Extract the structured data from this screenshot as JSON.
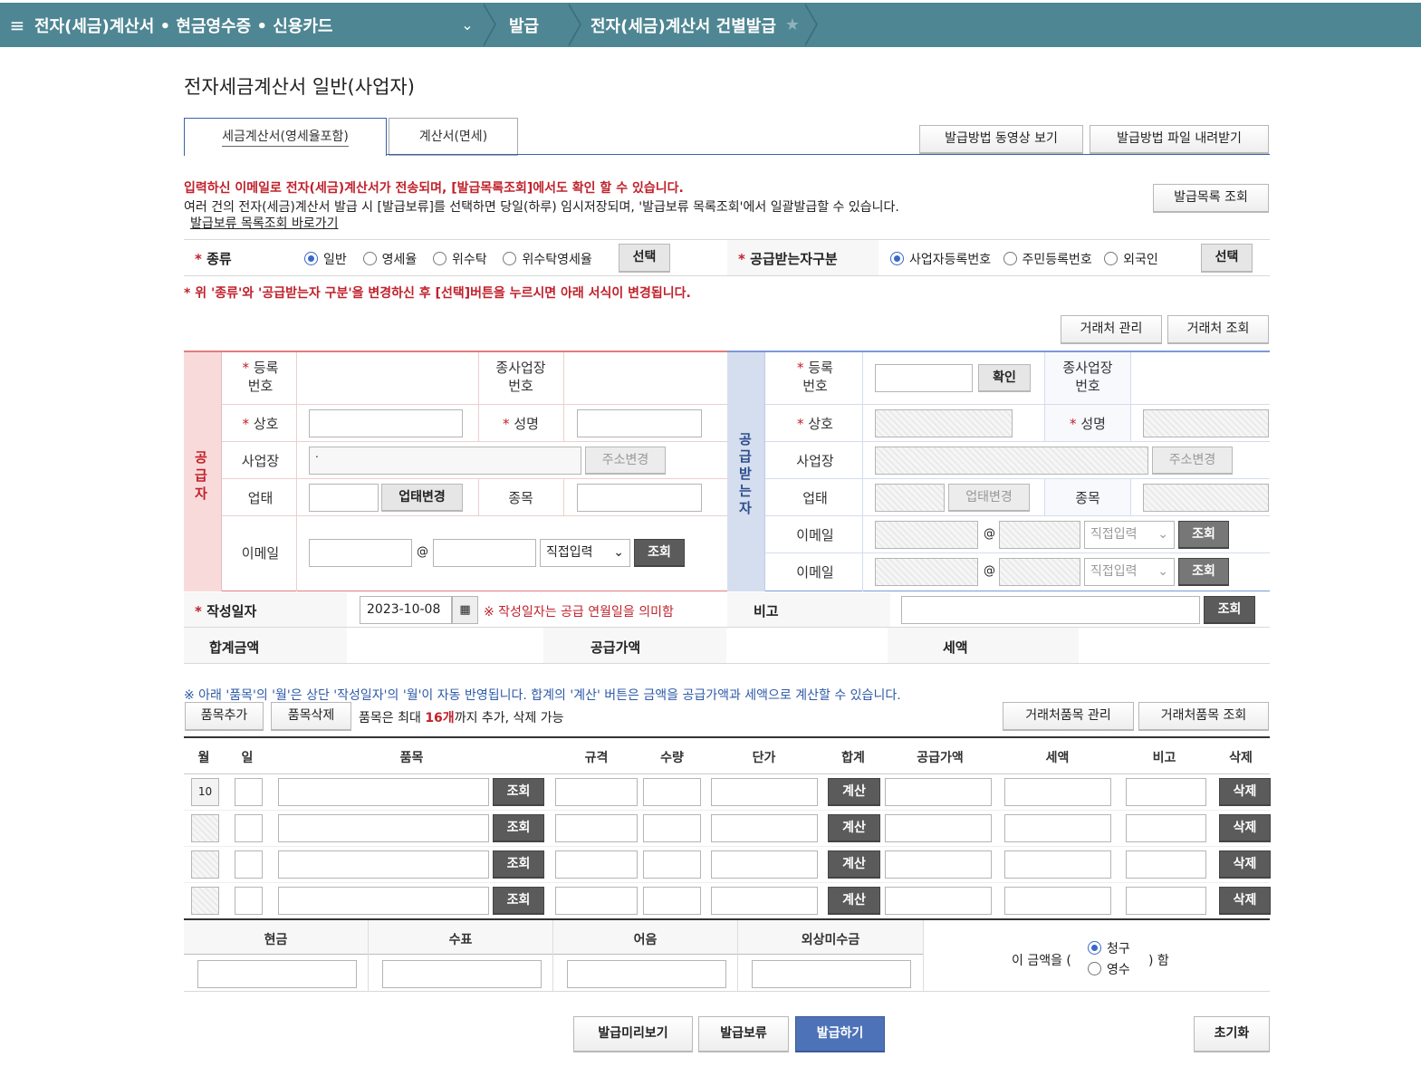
{
  "breadcrumb": {
    "menu": "≡",
    "section": "전자(세금)계산서 • 현금영수증 • 신용카드",
    "level2": "발급",
    "level3": "전자(세금)계산서 건별발급",
    "star": "★"
  },
  "page_title": "전자세금계산서 일반(사업자)",
  "tabs": [
    "세금계산서(영세율포함)",
    "계산서(면세)"
  ],
  "buttons": {
    "video": "발급방법 동영상 보기",
    "download": "발급방법 파일 내려받기",
    "issued_list": "발급목록 조회",
    "client_mgmt": "거래처 관리",
    "client_query": "거래처 조회",
    "item_mgmt": "거래처품목 관리",
    "item_query": "거래처품목 조회",
    "item_add": "품목추가",
    "item_del": "품목삭제",
    "preview": "발급미리보기",
    "hold": "발급보류",
    "issue": "발급하기",
    "reset": "초기화",
    "select": "선택",
    "confirm": "확인",
    "addr_change": "주소변경",
    "biz_change": "업태변경",
    "query": "조회",
    "calc": "계산",
    "delete": "삭제"
  },
  "notices": {
    "line1": "입력하신 이메일로 전자(세금)계산서가 전송되며, [발급목록조회]에서도 확인 할 수 있습니다.",
    "line2": "여러 건의 전자(세금)계산서 발급 시 [발급보류]를 선택하면 당일(하루) 임시저장되며, '발급보류 목록조회'에서 일괄발급할 수 있습니다.",
    "link": "발급보류 목록조회 바로가기",
    "form_change": "* 위 '종류'와 '공급받는자 구분'을 변경하신 후 [선택]버튼을 누르시면 아래 서식이 변경됩니다.",
    "item_note": "※ 아래 '품목'의 '월'은 상단 '작성일자'의 '월'이 자동 반영됩니다. 합계의 '계산' 버튼은 금액을 공급가액과 세액으로 계산할 수 있습니다.",
    "item_limit_pre": "품목은 최대 ",
    "item_limit_num": "16개",
    "item_limit_post": "까지 추가, 삭제 가능",
    "date_note": "※ 작성일자는 공급 연월일을 의미함"
  },
  "type_label": "종류",
  "type_options": [
    "일반",
    "영세율",
    "위수탁",
    "위수탁영세율"
  ],
  "recv_label": "공급받는자구분",
  "recv_options": [
    "사업자등록번호",
    "주민등록번호",
    "외국인"
  ],
  "supplier": {
    "side": "공급자",
    "reg_no": "등록\n번호",
    "sub_no": "종사업장\n번호",
    "name": "상호",
    "ceo": "성명",
    "addr": "사업장",
    "addr_value": ".",
    "biz": "업태",
    "item": "종목",
    "email": "이메일",
    "at": "@",
    "direct": "직접입력"
  },
  "receiver": {
    "side": "공급받는자",
    "reg_no": "등록\n번호",
    "sub_no": "종사업장\n번호",
    "name": "상호",
    "ceo": "성명",
    "addr": "사업장",
    "biz": "업태",
    "item": "종목",
    "email": "이메일",
    "email2": "이메일",
    "at": "@",
    "direct": "직접입력"
  },
  "date_label": "작성일자",
  "date_value": "2023-10-08",
  "memo_label": "비고",
  "totals": {
    "sum": "합계금액",
    "supply": "공급가액",
    "tax": "세액"
  },
  "item_headers": [
    "월",
    "일",
    "품목",
    "규격",
    "수량",
    "단가",
    "합계",
    "공급가액",
    "세액",
    "비고",
    "삭제"
  ],
  "first_month": "10",
  "payment_headers": [
    "현금",
    "수표",
    "어음",
    "외상미수금"
  ],
  "claim": {
    "pre": "이 금액을 (",
    "claim": "청구",
    "receipt": "영수",
    "post": ") 함"
  }
}
